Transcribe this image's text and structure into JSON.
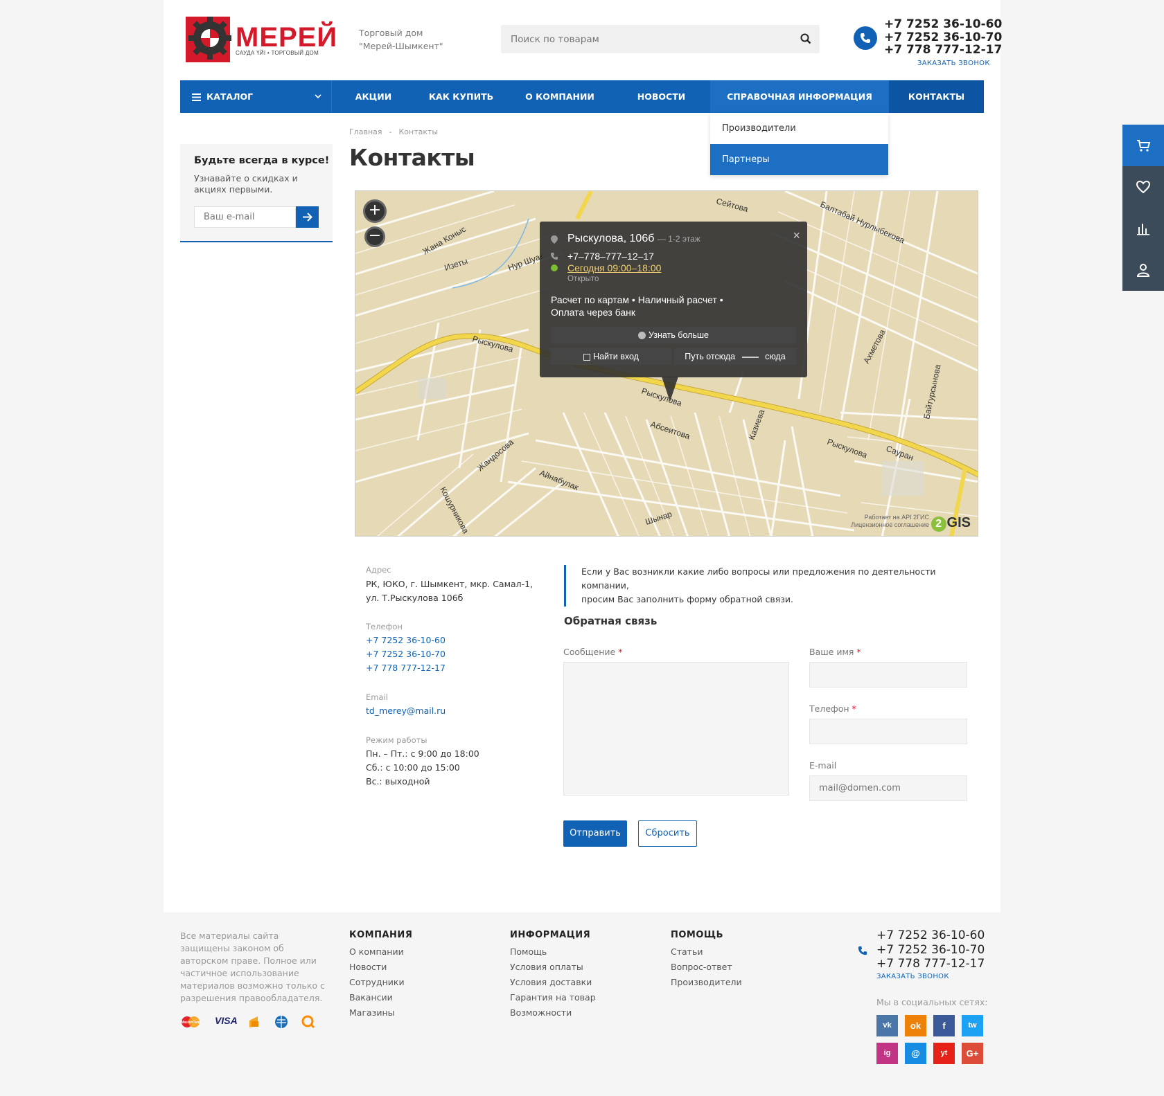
{
  "header": {
    "logo_text": "МЕРЕЙ",
    "logo_sub": "САУДА ҮЙІ • ТОРГОВЫЙ ДОМ",
    "tagline_line1": "Торговый дом",
    "tagline_line2": "\"Мерей-Шымкент\"",
    "search_placeholder": "Поиск по товарам",
    "phones": [
      "+7 7252 36-10-60",
      "+7 7252 36-10-70",
      "+7 778 777-12-17"
    ],
    "callback": "ЗАКАЗАТЬ ЗВОНОК"
  },
  "nav": {
    "catalog": "КАТАЛОГ",
    "items": [
      "АКЦИИ",
      "КАК КУПИТЬ",
      "О КОМПАНИИ",
      "НОВОСТИ",
      "СПРАВОЧНАЯ ИНФОРМАЦИЯ",
      "КОНТАКТЫ"
    ],
    "dropdown": [
      "Производители",
      "Партнеры"
    ]
  },
  "subscribe": {
    "title": "Будьте всегда в курсе!",
    "text": "Узнавайте о скидках и акциях первыми.",
    "placeholder": "Ваш e-mail"
  },
  "breadcrumb": [
    "Главная",
    "-",
    "Контакты"
  ],
  "title": "Контакты",
  "map": {
    "zoom_in": "+",
    "zoom_out": "−",
    "close": "×",
    "address": "Рыскулова, 106б",
    "floor": "— 1-2 этаж",
    "phone": "+7–778–777–12–17",
    "hours": "Сегодня 09:00–18:00",
    "status": "Открыто",
    "payment": "Расчет по картам • Наличный расчет • Оплата через банк",
    "more": "Узнать больше",
    "entrance": "Найти вход",
    "route_from": "Путь отсюда",
    "route_to": "сюда",
    "streets": [
      "Рыскулова",
      "Рыскулова",
      "Рыскулова",
      "Абсеитова",
      "Жандосова",
      "Айнабулак",
      "Кошурникова",
      "Казиева",
      "Ахметова",
      "Байтурсынова",
      "Сауран",
      "Сейтова",
      "Балтабай Нурлыбекова",
      "Жана Коныс",
      "Изеты",
      "Нур Шуак",
      "Шынар"
    ],
    "api_note_1": "Работает на API 2ГИС",
    "api_note_2": "Лицензионное соглашение",
    "gis_logo": "GIS",
    "gis_logo_num": "2"
  },
  "contacts": {
    "address_label": "Адрес",
    "address_line1": "РК, ЮКО, г. Шымкент, мкр. Самал-1,",
    "address_line2": "ул. Т.Рыскулова 106б",
    "phone_label": "Телефон",
    "phones": [
      "+7 7252 36-10-60",
      "+7 7252 36-10-70",
      "+7 778 777-12-17"
    ],
    "email_label": "Email",
    "email": "td_merey@mail.ru",
    "hours_label": "Режим работы",
    "hours": [
      "Пн. – Пт.: с 9:00 до 18:00",
      "Сб.: с 10:00 до 15:00",
      "Вс.: выходной"
    ]
  },
  "feedback": {
    "intro_line1": "Если у Вас возникли какие либо вопросы или предложения по деятельности компании,",
    "intro_line2": "просим Вас заполнить форму обратной связи.",
    "title": "Обратная связь",
    "message_label": "Сообщение",
    "name_label": "Ваше имя",
    "phone_label": "Телефон",
    "email_label": "E-mail",
    "email_placeholder": "mail@domen.com",
    "required_mark": "*",
    "send": "Отправить",
    "reset": "Сбросить"
  },
  "footer": {
    "copyright": "Все материалы сайта защищены законом об авторском праве. Полное или частичное использование материалов возможно только с разрешения правообладателя.",
    "payments": {
      "mastercard": "MasterCard",
      "visa": "VISA"
    },
    "columns": [
      {
        "title": "КОМПАНИЯ",
        "items": [
          "О компании",
          "Новости",
          "Сотрудники",
          "Вакансии",
          "Магазины"
        ]
      },
      {
        "title": "ИНФОРМАЦИЯ",
        "items": [
          "Помощь",
          "Условия оплаты",
          "Условия доставки",
          "Гарантия на товар",
          "Возможности"
        ]
      },
      {
        "title": "ПОМОЩЬ",
        "items": [
          "Статьи",
          "Вопрос-ответ",
          "Производители"
        ]
      }
    ],
    "phones": [
      "+7 7252 36-10-60",
      "+7 7252 36-10-70",
      "+7 778 777-12-17"
    ],
    "callback": "ЗАКАЗАТЬ ЗВОНОК",
    "social_title": "Мы в социальных сетях:",
    "social": [
      "vk",
      "ok",
      "f",
      "tw",
      "ig",
      "@",
      "yt",
      "G+"
    ]
  },
  "colors": {
    "primary": "#1162b5",
    "accent_red": "#d4192a",
    "map_bg": "#e8dcbc",
    "road_yellow": "#f2d64b"
  }
}
